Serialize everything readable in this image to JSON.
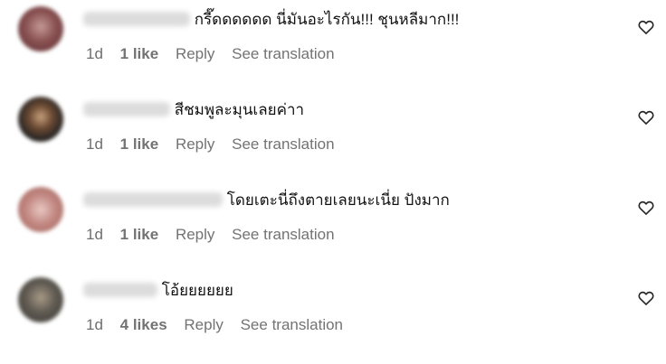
{
  "comments": [
    {
      "text": "กรี๊ดดดดดด นี่มันอะไรกัน!!! ชุนหลีมาก!!!",
      "time": "1d",
      "likes": "1 like",
      "reply": "Reply",
      "translate": "See translation",
      "like_icon": "heart-outline-icon"
    },
    {
      "text": "สีชมพูละมุนเลยค่าา",
      "time": "1d",
      "likes": "1 like",
      "reply": "Reply",
      "translate": "See translation",
      "like_icon": "heart-outline-icon"
    },
    {
      "text": "โดยเตะนี่ถึงตายเลยนะเนี่ย ปังมาก",
      "time": "1d",
      "likes": "1 like",
      "reply": "Reply",
      "translate": "See translation",
      "like_icon": "heart-outline-icon"
    },
    {
      "text": "โอ้ยยยยยย",
      "time": "1d",
      "likes": "4 likes",
      "reply": "Reply",
      "translate": "See translation",
      "like_icon": "heart-outline-icon"
    }
  ],
  "colors": {
    "text": "#111111",
    "meta": "#737373",
    "background": "#ffffff"
  }
}
